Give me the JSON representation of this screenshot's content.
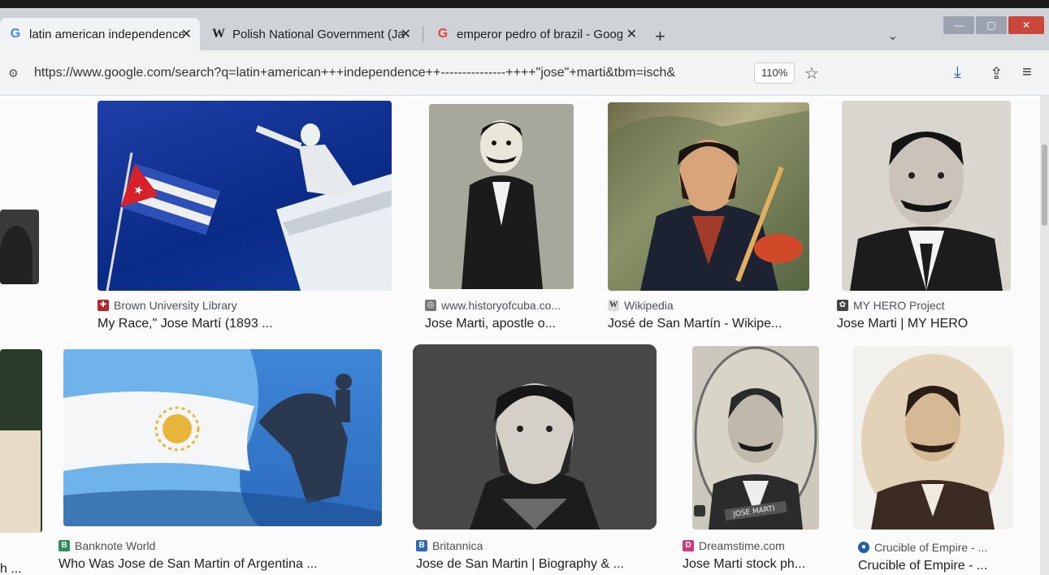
{
  "browser": {
    "tabs": [
      {
        "icon": "G",
        "title": "latin american independence -",
        "active": true
      },
      {
        "icon": "W",
        "title": "Polish National Government (Ja",
        "active": false
      },
      {
        "icon": "G",
        "title": "emperor pedro of brazil - Goog",
        "active": false
      }
    ],
    "new_tab": "+",
    "tab_close": "✕",
    "tab_list": "⌄",
    "url": "https://www.google.com/search?q=latin+american+++independence++---------------++++\"jose\"+marti&tbm=isch&",
    "zoom": "110%"
  },
  "results": {
    "row1": [
      {
        "source": "Brown University Library",
        "source_color": "#b3262d",
        "title": "My Race,\" Jose Martí (1893 ..."
      },
      {
        "source": "www.historyofcuba.co...",
        "source_color": "#777777",
        "title": "Jose Marti, apostle o..."
      },
      {
        "source": "Wikipedia",
        "source_color": "#555555",
        "title": "José de San Martín - Wikipe..."
      },
      {
        "source": "MY HERO Project",
        "source_color": "#444444",
        "title": "Jose Marti | MY HERO"
      }
    ],
    "row2": [
      {
        "source": "Banknote World",
        "source_color": "#2f8f5b",
        "title": "Who Was Jose de San Martin of Argentina ..."
      },
      {
        "source": "Britannica",
        "source_color": "#2f6bb3",
        "title": "Jose de San Martin | Biography & ..."
      },
      {
        "source": "Dreamstime.com",
        "source_color": "#d03a7d",
        "title": "Jose Marti stock ph..."
      },
      {
        "source": "Crucible of Empire - ...",
        "source_color": "#1f5fa8",
        "title": "Crucible of Empire - ..."
      }
    ],
    "left_cut_title": "h ..."
  }
}
